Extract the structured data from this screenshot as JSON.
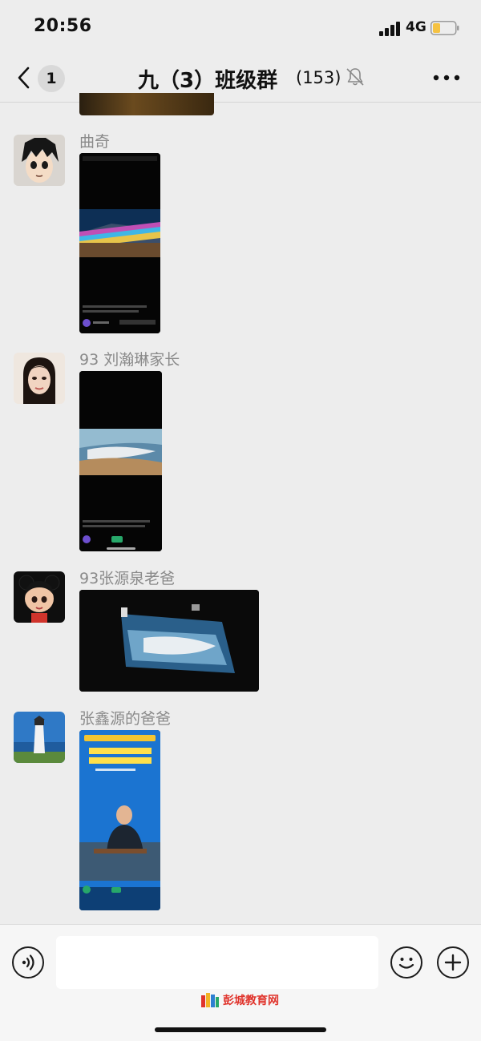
{
  "status_bar": {
    "time": "20:56",
    "network": "4G"
  },
  "nav": {
    "unread_count": "1",
    "title": "九（3）班级群",
    "member_count": "(153)"
  },
  "messages": [
    {
      "sender": "曲奇"
    },
    {
      "sender": "93 刘瀚琳家长"
    },
    {
      "sender": "93张源泉老爸"
    },
    {
      "sender": "张鑫源的爸爸"
    }
  ],
  "input": {
    "placeholder": ""
  },
  "watermark": {
    "text": "彭城教育网"
  },
  "colors": {
    "background": "#ededed",
    "sender_name": "#8a8a8a",
    "input_bar": "#f6f6f6",
    "battery": "#f5c242"
  }
}
